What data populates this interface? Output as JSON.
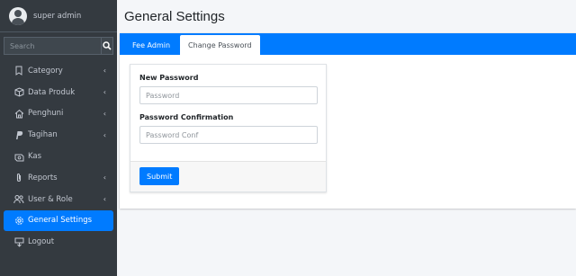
{
  "user": {
    "name": "super admin"
  },
  "search": {
    "placeholder": "Search"
  },
  "sidebar": {
    "items": [
      {
        "label": "Category",
        "icon": "bookmark-icon",
        "chevron": true
      },
      {
        "label": "Data Produk",
        "icon": "box-icon",
        "chevron": true
      },
      {
        "label": "Penghuni",
        "icon": "home-icon",
        "chevron": true
      },
      {
        "label": "Tagihan",
        "icon": "paypal-icon",
        "chevron": true
      },
      {
        "label": "Kas",
        "icon": "cash-icon",
        "chevron": false
      },
      {
        "label": "Reports",
        "icon": "paperclip-icon",
        "chevron": true
      },
      {
        "label": "User & Role",
        "icon": "users-icon",
        "chevron": true
      },
      {
        "label": "General Settings",
        "icon": "gear-icon",
        "chevron": false,
        "active": true
      },
      {
        "label": "Logout",
        "icon": "logout-icon",
        "chevron": false
      }
    ]
  },
  "header": {
    "title": "General Settings"
  },
  "tabs": [
    {
      "label": "Fee Admin"
    },
    {
      "label": "Change Password",
      "active": true
    }
  ],
  "form": {
    "new_password_label": "New Password",
    "new_password_placeholder": "Password",
    "confirm_label": "Password Confirmation",
    "confirm_placeholder": "Password Conf",
    "submit_label": "Submit"
  },
  "colors": {
    "sidebar_bg": "#343a40",
    "accent": "#007bff"
  }
}
